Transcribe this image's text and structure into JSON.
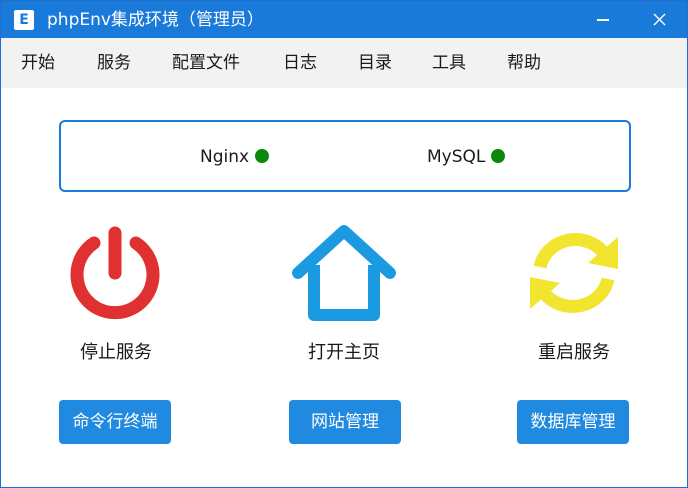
{
  "titlebar": {
    "icon_letter": "E",
    "title": "phpEnv集成环境（管理员）"
  },
  "menu": [
    {
      "label": "开始"
    },
    {
      "label": "服务"
    },
    {
      "label": "配置文件"
    },
    {
      "label": "日志"
    },
    {
      "label": "目录"
    },
    {
      "label": "工具"
    },
    {
      "label": "帮助"
    }
  ],
  "services": [
    {
      "name": "Nginx",
      "status": "running",
      "color": "#0a8a0a"
    },
    {
      "name": "MySQL",
      "status": "running",
      "color": "#0a8a0a"
    }
  ],
  "actions": {
    "stop": {
      "label": "停止服务",
      "icon": "power-icon",
      "color": "#e03131"
    },
    "home": {
      "label": "打开主页",
      "icon": "home-icon",
      "color": "#1a9ae0"
    },
    "restart": {
      "label": "重启服务",
      "icon": "refresh-icon",
      "color": "#f2e530"
    }
  },
  "buttons": {
    "terminal": "命令行终端",
    "site": "网站管理",
    "database": "数据库管理"
  }
}
